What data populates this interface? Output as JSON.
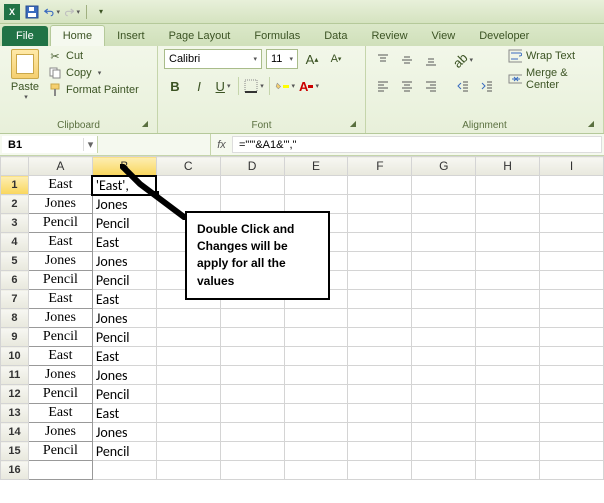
{
  "qat": {
    "excel_letter": "X"
  },
  "tabs": {
    "file": "File",
    "items": [
      "Home",
      "Insert",
      "Page Layout",
      "Formulas",
      "Data",
      "Review",
      "View",
      "Developer"
    ],
    "active": "Home"
  },
  "ribbon": {
    "clipboard": {
      "paste": "Paste",
      "cut": "Cut",
      "copy": "Copy",
      "format_painter": "Format Painter",
      "group_label": "Clipboard"
    },
    "font": {
      "name": "Calibri",
      "size": "11",
      "group_label": "Font"
    },
    "alignment": {
      "wrap": "Wrap Text",
      "merge": "Merge & Center",
      "group_label": "Alignment"
    }
  },
  "namebox": "B1",
  "formula": "=\"'\"&A1&\"',\"",
  "columns": [
    "A",
    "B",
    "C",
    "D",
    "E",
    "F",
    "G",
    "H",
    "I"
  ],
  "rows": [
    {
      "n": "1",
      "a": "East",
      "b": "'East',"
    },
    {
      "n": "2",
      "a": "Jones",
      "b": "Jones"
    },
    {
      "n": "3",
      "a": "Pencil",
      "b": "Pencil"
    },
    {
      "n": "4",
      "a": "East",
      "b": "East"
    },
    {
      "n": "5",
      "a": "Jones",
      "b": "Jones"
    },
    {
      "n": "6",
      "a": "Pencil",
      "b": "Pencil"
    },
    {
      "n": "7",
      "a": "East",
      "b": "East"
    },
    {
      "n": "8",
      "a": "Jones",
      "b": "Jones"
    },
    {
      "n": "9",
      "a": "Pencil",
      "b": "Pencil"
    },
    {
      "n": "10",
      "a": "East",
      "b": "East"
    },
    {
      "n": "11",
      "a": "Jones",
      "b": "Jones"
    },
    {
      "n": "12",
      "a": "Pencil",
      "b": "Pencil"
    },
    {
      "n": "13",
      "a": "East",
      "b": "East"
    },
    {
      "n": "14",
      "a": "Jones",
      "b": "Jones"
    },
    {
      "n": "15",
      "a": "Pencil",
      "b": "Pencil"
    },
    {
      "n": "16",
      "a": "",
      "b": ""
    }
  ],
  "callout": "Double Click and Changes will be apply for all the values"
}
